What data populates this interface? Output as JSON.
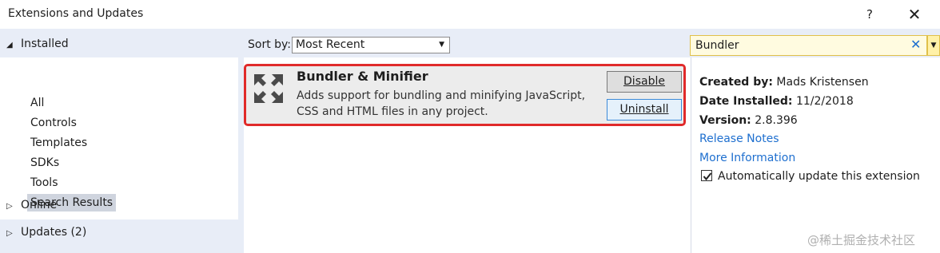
{
  "window": {
    "title": "Extensions and Updates",
    "help": "?",
    "close": "✕"
  },
  "left": {
    "installed": "Installed",
    "items": [
      {
        "label": "All"
      },
      {
        "label": "Controls"
      },
      {
        "label": "Templates"
      },
      {
        "label": "SDKs"
      },
      {
        "label": "Tools"
      },
      {
        "label": "Search Results",
        "selected": true
      }
    ],
    "online": "Online",
    "updates": "Updates (2)"
  },
  "toolbar": {
    "sort_label": "Sort by:",
    "sort_value": "Most Recent",
    "search_value": "Bundler"
  },
  "extension": {
    "name": "Bundler & Minifier",
    "description_line1": "Adds support for bundling and minifying JavaScript,",
    "description_line2": "CSS and HTML files in any project.",
    "disable_label": "Disable",
    "uninstall_label": "Uninstall"
  },
  "details": {
    "created_by_label": "Created by:",
    "created_by": "Mads Kristensen",
    "date_label": "Date Installed:",
    "date": "11/2/2018",
    "version_label": "Version:",
    "version": "2.8.396",
    "release_notes": "Release Notes",
    "more_info": "More Information",
    "auto_update_label": "Automatically update this extension",
    "auto_update_checked": true
  },
  "watermark": "@稀土掘金技术社区",
  "colors": {
    "accent": "#1e6fcf",
    "highlight": "#e02a2a",
    "panel": "#e8edf7"
  }
}
